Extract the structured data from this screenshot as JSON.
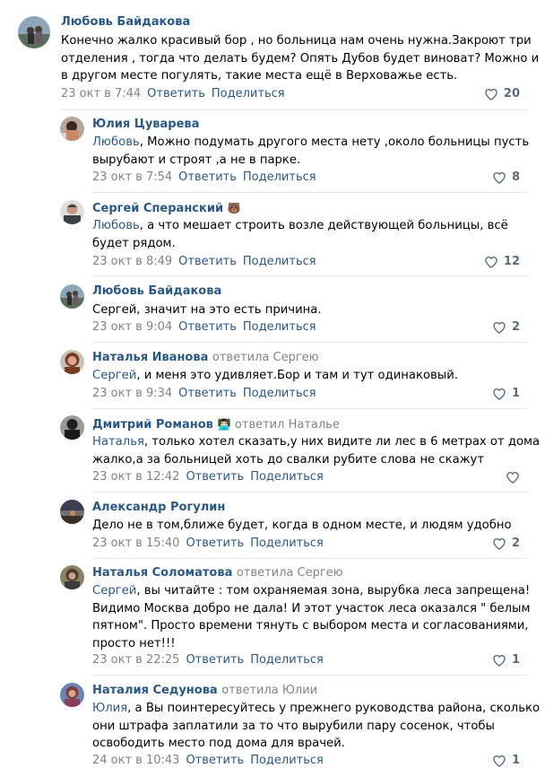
{
  "actions": {
    "reply": "Ответить",
    "share": "Поделиться"
  },
  "comments": [
    {
      "author": "Любовь Байдакова",
      "replied": "",
      "emoji": "",
      "addressee": "",
      "lines": [
        "Конечно жалко красивый бор , но больница нам очень нужна.Закроют три",
        "отделения , тогда что делать будем? Опять Дубов будет виноват? Можно и",
        "в другом месте погулять, такие места ещё в Верховажье есть."
      ],
      "date": "23 окт в 7:44",
      "likes": "20"
    },
    {
      "author": "Юлия Цуварева",
      "replied": "",
      "emoji": "",
      "addressee": "Любовь",
      "lines": [
        ", Можно подумать другого места нету ,около больницы пусть",
        "вырубают и строят ,а не в парке."
      ],
      "date": "23 окт в 7:54",
      "likes": "8"
    },
    {
      "author": "Сергей Сперанский",
      "replied": "",
      "emoji": "🐻",
      "addressee": "Любовь",
      "lines": [
        ", а что мешает строить возле действующей больницы, всё",
        "будет рядом."
      ],
      "date": "23 окт в 8:49",
      "likes": "12"
    },
    {
      "author": "Любовь Байдакова",
      "replied": "",
      "emoji": "",
      "addressee": "",
      "lines": [
        "Сергей, значит на это есть причина."
      ],
      "date": "23 окт в 9:04",
      "likes": "2"
    },
    {
      "author": "Наталья Иванова",
      "replied": "ответила Сергею",
      "emoji": "",
      "addressee": "Сергей",
      "lines": [
        ", и меня это удивляет.Бор и там и тут одинаковый."
      ],
      "date": "23 окт в 9:34",
      "likes": "1"
    },
    {
      "author": "Дмитрий Романов",
      "replied": "ответил Наталье",
      "emoji": "👨🏻‍💻",
      "addressee": "Наталья",
      "lines": [
        ", только хотел сказать,у них видите ли лес в 6 метрах от дома",
        "жалко,а за больницей хоть до свалки рубите слова не скажут"
      ],
      "date": "23 окт в 12:42",
      "likes": ""
    },
    {
      "author": "Александр Рогулин",
      "replied": "",
      "emoji": "",
      "addressee": "",
      "lines": [
        "Дело не в том,ближе будет, когда в одном месте, и людям удобно"
      ],
      "date": "23 окт в 15:40",
      "likes": "2"
    },
    {
      "author": "Наталья Соломатова",
      "replied": "ответила Сергею",
      "emoji": "",
      "addressee": "Сергей",
      "lines": [
        ", вы читайте : том охраняемая зона, вырубка леса запрещена!",
        "Видимо Москва добро не дала! И этот участок леса оказался \" белым",
        "пятном\". Просто времени тянуть с выбором места и согласованиями,",
        "просто нет!!!"
      ],
      "date": "23 окт в 22:25",
      "likes": "1"
    },
    {
      "author": "Наталия Седунова",
      "replied": "ответила Юлии",
      "emoji": "",
      "addressee": "Юлия",
      "lines": [
        ", а Вы поинтересуйтесь у прежнего руководства района, сколько",
        "они штрафа заплатили за то что вырубили пару сосенок, чтобы",
        "освободить место под дома для врачей."
      ],
      "date": "24 окт в 10:43",
      "likes": "1"
    }
  ]
}
